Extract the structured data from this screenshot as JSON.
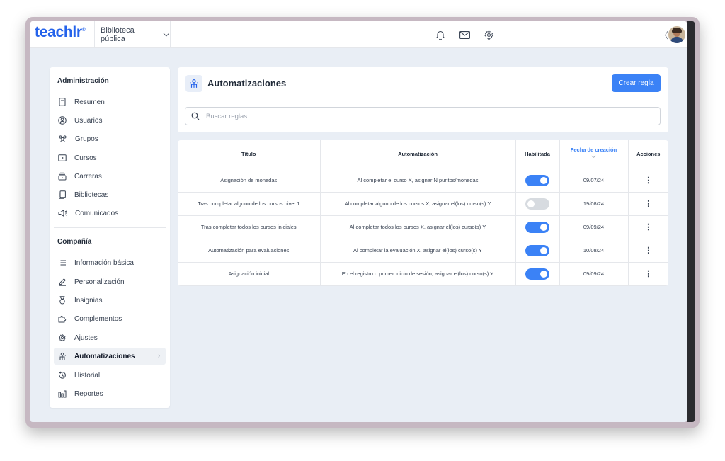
{
  "app": {
    "logo": "teachlr",
    "logo_mark": "®",
    "library": "Biblioteca pública"
  },
  "topbar": {
    "icons": [
      "bell-icon",
      "mail-icon",
      "gear-icon"
    ],
    "collapse_icon": "chevron-left-icon"
  },
  "sidebar": {
    "admin_heading": "Administración",
    "admin_items": [
      {
        "label": "Resumen",
        "icon": "document-icon"
      },
      {
        "label": "Usuarios",
        "icon": "user-circle-icon"
      },
      {
        "label": "Grupos",
        "icon": "users-icon"
      },
      {
        "label": "Cursos",
        "icon": "play-box-icon"
      },
      {
        "label": "Carreras",
        "icon": "stack-icon"
      },
      {
        "label": "Bibliotecas",
        "icon": "library-icon"
      },
      {
        "label": "Comunicados",
        "icon": "megaphone-icon"
      }
    ],
    "company_heading": "Compañía",
    "company_items": [
      {
        "label": "Información básica",
        "icon": "list-icon"
      },
      {
        "label": "Personalización",
        "icon": "pencil-icon"
      },
      {
        "label": "Insignias",
        "icon": "medal-icon"
      },
      {
        "label": "Complementos",
        "icon": "puzzle-icon"
      },
      {
        "label": "Ajustes",
        "icon": "gear-icon"
      },
      {
        "label": "Automatizaciones",
        "icon": "automation-icon",
        "active": true
      },
      {
        "label": "Historial",
        "icon": "history-icon"
      },
      {
        "label": "Reportes",
        "icon": "bar-chart-icon"
      }
    ]
  },
  "page": {
    "title": "Automatizaciones",
    "create_button": "Crear regla",
    "search_placeholder": "Buscar reglas"
  },
  "table": {
    "columns": [
      "Título",
      "Automatización",
      "Habilitada",
      "Fecha de creación",
      "Acciones"
    ],
    "sorted_column": "Fecha de creación",
    "rows": [
      {
        "title": "Asignación de monedas",
        "automation": "Al completar el curso X, asignar N puntos/monedas",
        "enabled": true,
        "date": "09/07/24",
        "actions": "⋮"
      },
      {
        "title": "Tras completar alguno de los cursos nivel 1",
        "automation": "Al completar alguno de los cursos X, asignar el(los) curso(s) Y",
        "enabled": false,
        "date": "19/08/24",
        "actions": "⋮"
      },
      {
        "title": "Tras completar todos los cursos iniciales",
        "automation": "Al completar todos los cursos X, asignar el(los) curso(s) Y",
        "enabled": true,
        "date": "09/09/24",
        "actions": "⋮"
      },
      {
        "title": "Automatización para evaluaciones",
        "automation": "Al completar la evaluación X, asignar el(los) curso(s) Y",
        "enabled": true,
        "date": "10/08/24",
        "actions": "⋮"
      },
      {
        "title": "Asignación inicial",
        "automation": "En el registro o primer inicio de sesión, asignar el(los) curso(s) Y",
        "enabled": true,
        "date": "09/09/24",
        "actions": "⋮"
      }
    ]
  },
  "colors": {
    "accent": "#3b82f6",
    "background": "#e9eef5",
    "toggle_off": "#d7dbe0",
    "frame": "#c6b8c2"
  }
}
